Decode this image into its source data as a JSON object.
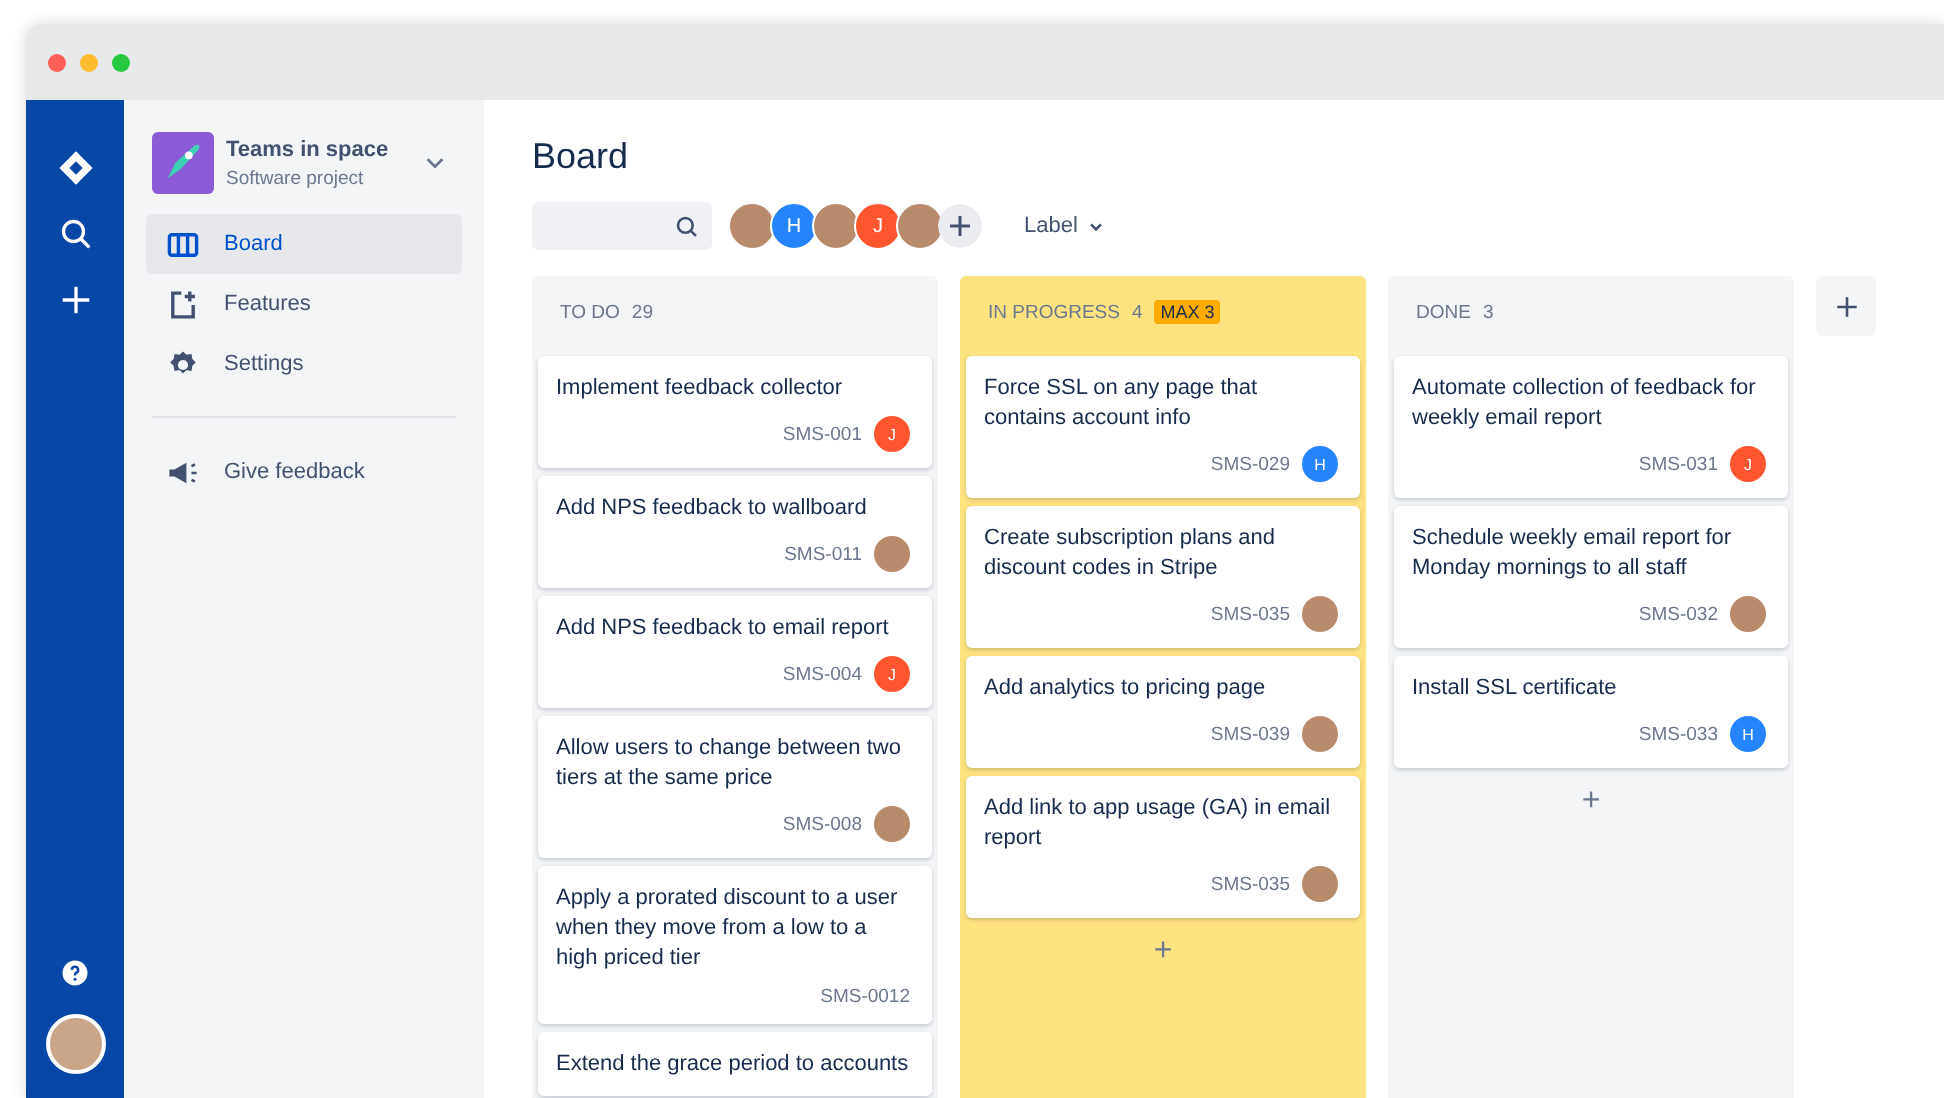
{
  "sidebar": {
    "project": {
      "name": "Teams in space",
      "type": "Software project"
    },
    "items": [
      {
        "label": "Board",
        "kind": "board",
        "selected": true
      },
      {
        "label": "Features",
        "kind": "features",
        "selected": false
      },
      {
        "label": "Settings",
        "kind": "settings",
        "selected": false
      }
    ],
    "footer_items": [
      {
        "label": "Give feedback",
        "kind": "feedback"
      }
    ]
  },
  "board": {
    "title": "Board",
    "filter_avatars": [
      {
        "kind": "photo"
      },
      {
        "kind": "letter",
        "initial": "H",
        "color": "#2684ff"
      },
      {
        "kind": "photo"
      },
      {
        "kind": "letter",
        "initial": "J",
        "color": "#ff5630"
      },
      {
        "kind": "photo"
      }
    ],
    "label_filter": "Label",
    "columns": [
      {
        "title": "TO DO",
        "count": "29",
        "over_limit": false,
        "cards": [
          {
            "title": "Implement feedback collector",
            "key": "SMS-001",
            "assignee": {
              "kind": "letter",
              "initial": "J",
              "color": "#ff5630"
            }
          },
          {
            "title": "Add NPS feedback to wallboard",
            "key": "SMS-011",
            "assignee": {
              "kind": "photo"
            }
          },
          {
            "title": "Add NPS feedback to email report",
            "key": "SMS-004",
            "assignee": {
              "kind": "letter",
              "initial": "J",
              "color": "#ff5630"
            }
          },
          {
            "title": "Allow users to change between two tiers at the same price",
            "key": "SMS-008",
            "assignee": {
              "kind": "photo"
            }
          },
          {
            "title": "Apply a prorated discount to a user when they move from a low to a high priced tier",
            "key": "SMS-0012"
          },
          {
            "title": "Extend the grace period to accounts"
          }
        ]
      },
      {
        "title": "IN PROGRESS",
        "count": "4",
        "limit": "MAX 3",
        "over_limit": true,
        "add": "+",
        "cards": [
          {
            "title": "Force SSL on any page that contains account info",
            "key": "SMS-029",
            "assignee": {
              "kind": "letter",
              "initial": "H",
              "color": "#2684ff"
            }
          },
          {
            "title": "Create subscription plans and discount codes in Stripe",
            "key": "SMS-035",
            "assignee": {
              "kind": "photo"
            }
          },
          {
            "title": "Add analytics to pricing page",
            "key": "SMS-039",
            "assignee": {
              "kind": "photo"
            }
          },
          {
            "title": "Add link to app usage (GA) in email report",
            "key": "SMS-035",
            "assignee": {
              "kind": "photo"
            }
          }
        ]
      },
      {
        "title": "DONE",
        "count": "3",
        "over_limit": false,
        "add": "+",
        "cards": [
          {
            "title": "Automate collection of feedback for weekly email report",
            "key": "SMS-031",
            "assignee": {
              "kind": "letter",
              "initial": "J",
              "color": "#ff5630"
            }
          },
          {
            "title": "Schedule weekly email report for Monday mornings to all staff",
            "key": "SMS-032",
            "assignee": {
              "kind": "photo"
            }
          },
          {
            "title": "Install SSL certificate",
            "key": "SMS-033",
            "assignee": {
              "kind": "letter",
              "initial": "H",
              "color": "#2684ff"
            }
          }
        ]
      }
    ]
  }
}
